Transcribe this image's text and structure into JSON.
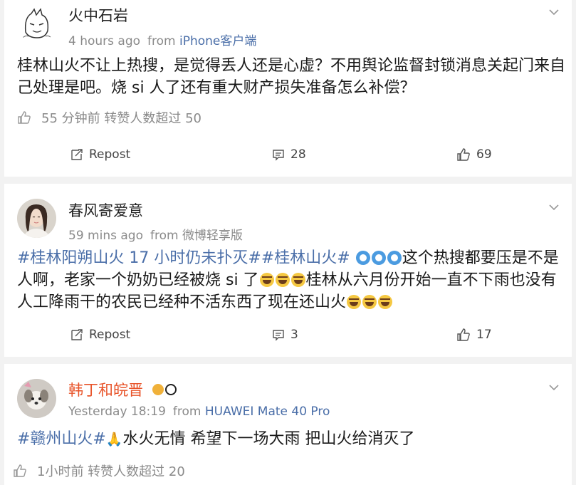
{
  "posts": [
    {
      "username": "火中石岩",
      "time": "4 hours ago",
      "source_prefix": "from",
      "source": "iPhone客户端",
      "text": "桂林山火不让上热搜，是觉得丢人还是心虚？不用舆论监督封锁消息关起门来自己处理是吧。烧 si 人了还有重大财产损失准备怎么补偿？",
      "like_note": "55 分钟前  转赞人数超过 50",
      "repost_label": "Repost",
      "comment_count": "28",
      "like_count": "69"
    },
    {
      "username": "春风寄爱意",
      "time": "59 mins ago",
      "source_prefix": "from",
      "source": "微博轻享版",
      "hashtag1": "#桂林阳朔山火 17 小时仍未扑灭#",
      "hashtag2": "#桂林山火#",
      "text_a": "这个热搜都要压是不是人啊，老家一个奶奶已经被烧 si 了",
      "text_b": "桂林从六月份开始一直不下雨也没有人工降雨干的农民已经种不活东西了现在还山火",
      "repost_label": "Repost",
      "comment_count": "3",
      "like_count": "17"
    },
    {
      "username": "韩丁和皖晋",
      "time": "Yesterday 18:19",
      "source_prefix": "from",
      "source": "HUAWEI Mate 40 Pro",
      "hashtag1": "#赣州山火#",
      "text": "水火无情 希望下一场大雨 把山火给消灭了",
      "like_note": "1小时前  转赞人数超过 20"
    }
  ],
  "colors": {
    "link": "#4a6ea8",
    "username_vip": "#e8542a",
    "meta": "#8a8a8a"
  }
}
